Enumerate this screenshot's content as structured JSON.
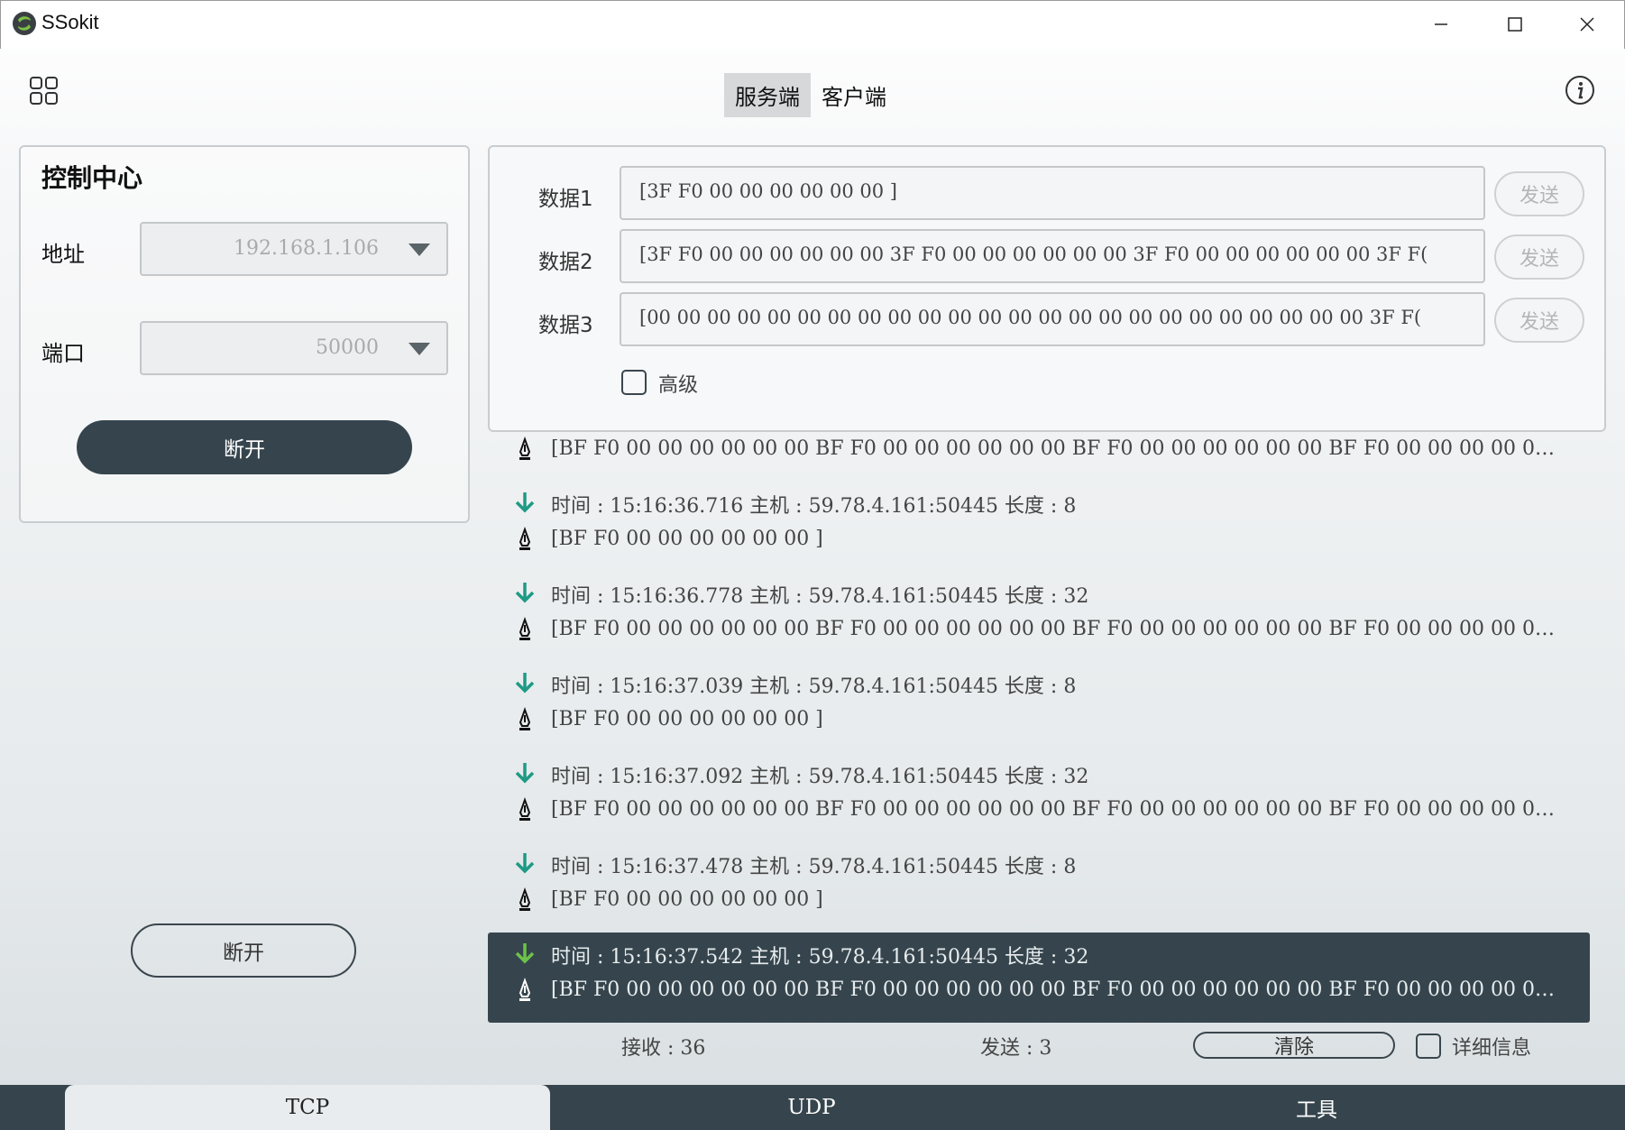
{
  "app": {
    "title": "SSokit"
  },
  "header": {
    "tabs": [
      "服务端",
      "客户端"
    ]
  },
  "control": {
    "title": "控制中心",
    "address_label": "地址",
    "address_value": "192.168.1.106",
    "port_label": "端口",
    "port_value": "50000",
    "disconnect_label": "断开",
    "disconnect_secondary_label": "断开"
  },
  "data_send": {
    "rows": [
      {
        "label": "数据1",
        "value": "[3F F0 00 00 00 00 00 00 ]",
        "send": "发送"
      },
      {
        "label": "数据2",
        "value": "[3F F0 00 00 00 00 00 00 3F F0 00 00 00 00 00 00 3F F0 00 00 00 00 00 00 3F F(",
        "send": "发送"
      },
      {
        "label": "数据3",
        "value": "[00 00 00 00 00 00 00 00 00 00 00 00 00 00 00 00 00 00 00 00 00 00 00 00 3F F(",
        "send": "发送"
      }
    ],
    "advanced_label": "高级"
  },
  "log": [
    "[BF F0 00 00 00 00 00 00 BF F0 00 00 00 00 00 00 BF F0 00 00 00 00 00 00 BF F0 00 00 00 00 0…",
    "时间 :  15:16:36.716  主机 :   59.78.4.161:50445 长度 :   8",
    "[BF F0 00 00 00 00 00 00 ]",
    "时间 :  15:16:36.778  主机 :   59.78.4.161:50445 长度 :   32",
    "[BF F0 00 00 00 00 00 00 BF F0 00 00 00 00 00 00 BF F0 00 00 00 00 00 00 BF F0 00 00 00 00 0…",
    "时间 :  15:16:37.039  主机 :   59.78.4.161:50445 长度 :   8",
    "[BF F0 00 00 00 00 00 00 ]",
    "时间 :  15:16:37.092  主机 :   59.78.4.161:50445 长度 :   32",
    "[BF F0 00 00 00 00 00 00 BF F0 00 00 00 00 00 00 BF F0 00 00 00 00 00 00 BF F0 00 00 00 00 0…",
    "时间 :  15:16:37.478  主机 :   59.78.4.161:50445 长度 :   8",
    "[BF F0 00 00 00 00 00 00 ]",
    "时间 :  15:16:37.542  主机 :   59.78.4.161:50445 长度 :   32",
    "[BF F0 00 00 00 00 00 00 BF F0 00 00 00 00 00 00 BF F0 00 00 00 00 00 00 BF F0 00 00 00 00 0…"
  ],
  "footer": {
    "receive": "接收 : 36",
    "send": "发送 : 3",
    "clear_label": "清除",
    "detail_label": "详细信息"
  },
  "bottom_tabs": [
    "TCP",
    "UDP",
    "工具"
  ],
  "colors": {
    "accent_dark": "#36454d",
    "arrow_green": "#1e9a85",
    "arrow_selected": "#6cc24a"
  }
}
